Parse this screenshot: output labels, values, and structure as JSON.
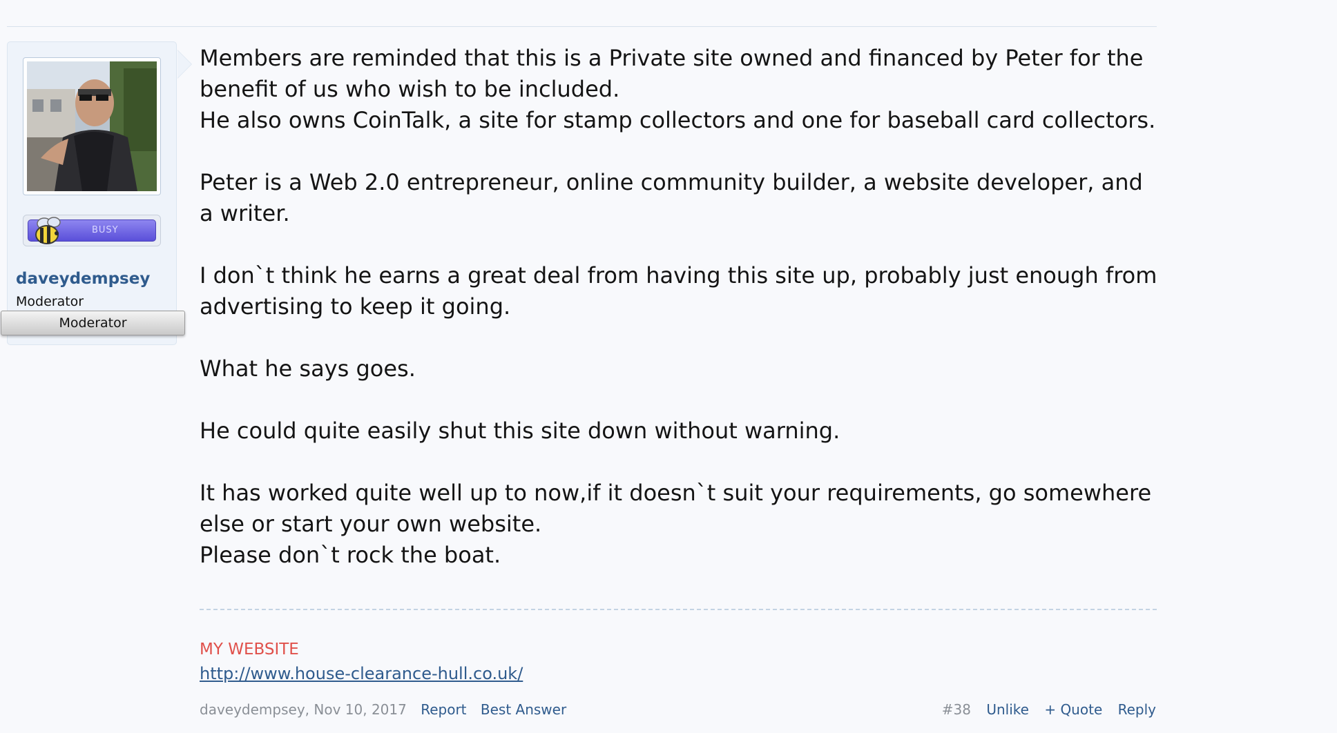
{
  "user": {
    "username": "daveydempsey",
    "title": "Moderator",
    "banner": "Moderator",
    "status_badge": "BUSY"
  },
  "message": {
    "paragraphs": [
      "Members are reminded that this is a Private site owned and financed by Peter for the benefit of us who wish to be included.",
      "He also owns CoinTalk, a site for stamp collectors and one for baseball card collectors.",
      "",
      "Peter is a Web 2.0 entrepreneur, online community builder, a website developer, and a writer.",
      "",
      "I don`t think he earns a great deal from having this site up, probably just enough from advertising to keep it going.",
      "",
      "What he says goes.",
      "",
      "He could quite easily shut this site down without warning.",
      "",
      "It has worked quite well up to now,if it doesn`t suit your requirements, go somewhere else or start your own website.",
      "Please don`t rock the boat."
    ]
  },
  "signature": {
    "heading": "MY WEBSITE",
    "link": "http://www.house-clearance-hull.co.uk/"
  },
  "meta": {
    "author": "daveydempsey",
    "separator": ",",
    "date": "Nov 10, 2017",
    "report": "Report",
    "best_answer": "Best Answer",
    "post_number": "#38",
    "unlike": "Unlike",
    "quote": "+ Quote",
    "reply": "Reply"
  },
  "colors": {
    "background": "#f8f9fc",
    "link": "#2f5b8d",
    "signature_heading": "#e0504a",
    "badge": "#5a4fd9"
  }
}
